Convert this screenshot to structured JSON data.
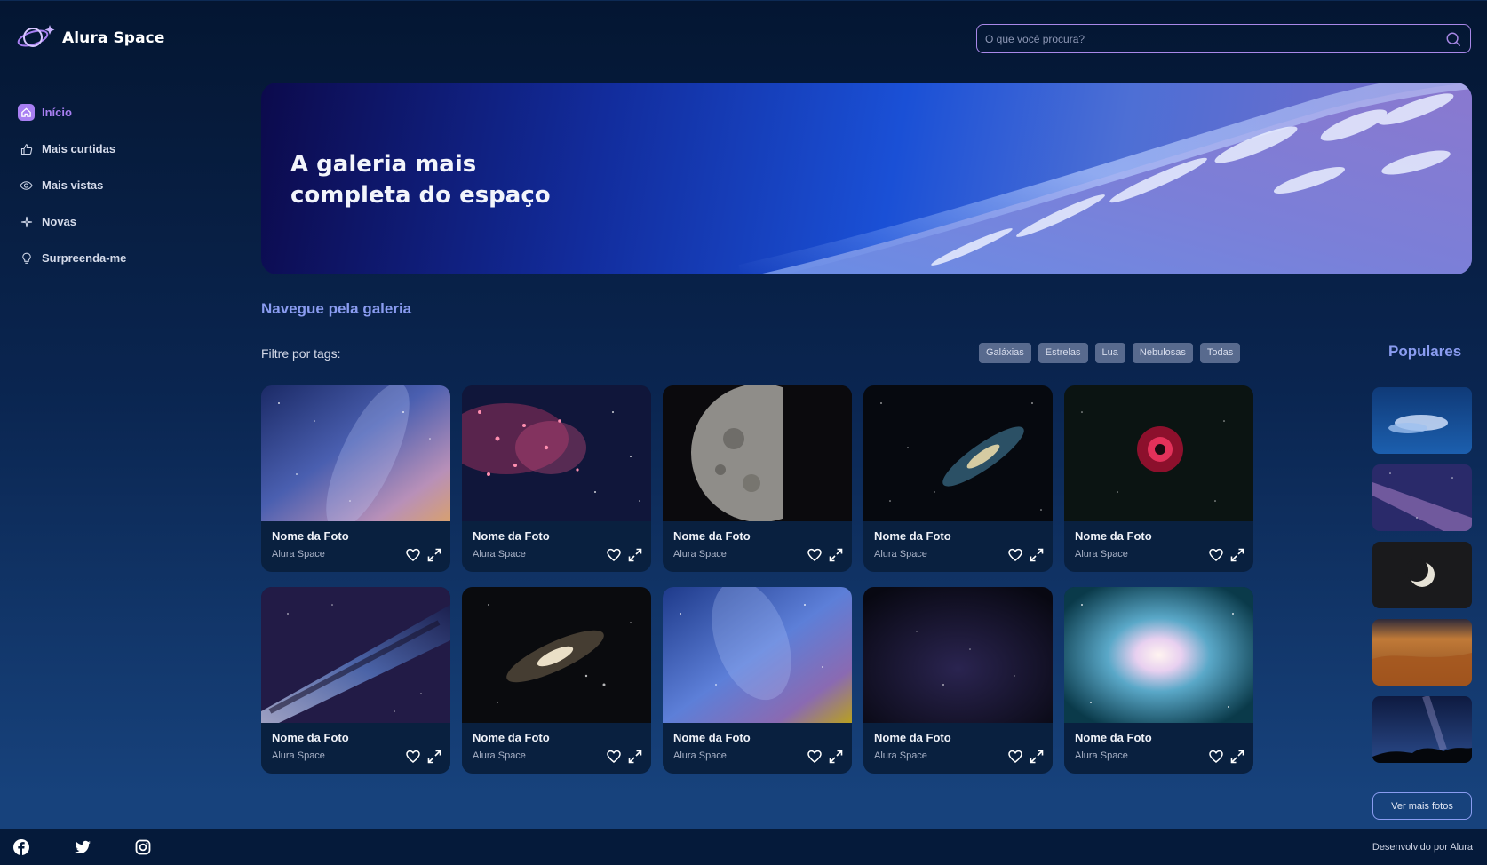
{
  "brand": {
    "name": "Alura Space"
  },
  "search": {
    "placeholder": "O que você procura?"
  },
  "sidebar": {
    "items": [
      {
        "label": "Início",
        "icon": "home-icon",
        "active": true
      },
      {
        "label": "Mais curtidas",
        "icon": "thumbs-up-icon",
        "active": false
      },
      {
        "label": "Mais vistas",
        "icon": "eye-icon",
        "active": false
      },
      {
        "label": "Novas",
        "icon": "sparkle-icon",
        "active": false
      },
      {
        "label": "Surpreenda-me",
        "icon": "lightbulb-icon",
        "active": false
      }
    ]
  },
  "banner": {
    "title": "A galeria mais\ncompleta do espaço"
  },
  "gallery": {
    "section_title": "Navegue pela galeria",
    "filter_label": "Filtre por tags:",
    "tags": [
      "Galáxias",
      "Estrelas",
      "Lua",
      "Nebulosas",
      "Todas"
    ],
    "cards": [
      {
        "title": "Nome da Foto",
        "author": "Alura Space"
      },
      {
        "title": "Nome da Foto",
        "author": "Alura Space"
      },
      {
        "title": "Nome da Foto",
        "author": "Alura Space"
      },
      {
        "title": "Nome da Foto",
        "author": "Alura Space"
      },
      {
        "title": "Nome da Foto",
        "author": "Alura Space"
      },
      {
        "title": "Nome da Foto",
        "author": "Alura Space"
      },
      {
        "title": "Nome da Foto",
        "author": "Alura Space"
      },
      {
        "title": "Nome da Foto",
        "author": "Alura Space"
      },
      {
        "title": "Nome da Foto",
        "author": "Alura Space"
      },
      {
        "title": "Nome da Foto",
        "author": "Alura Space"
      }
    ]
  },
  "popular": {
    "title": "Populares",
    "more_label": "Ver mais fotos"
  },
  "footer": {
    "text": "Desenvolvido por Alura",
    "social": [
      "facebook-icon",
      "twitter-icon",
      "instagram-icon"
    ]
  },
  "colors": {
    "accent": "#a87ff2",
    "heading": "#8a9cf0",
    "background_top": "#041632",
    "background_bottom": "#17427c",
    "tag_bg": "#586a8e"
  }
}
